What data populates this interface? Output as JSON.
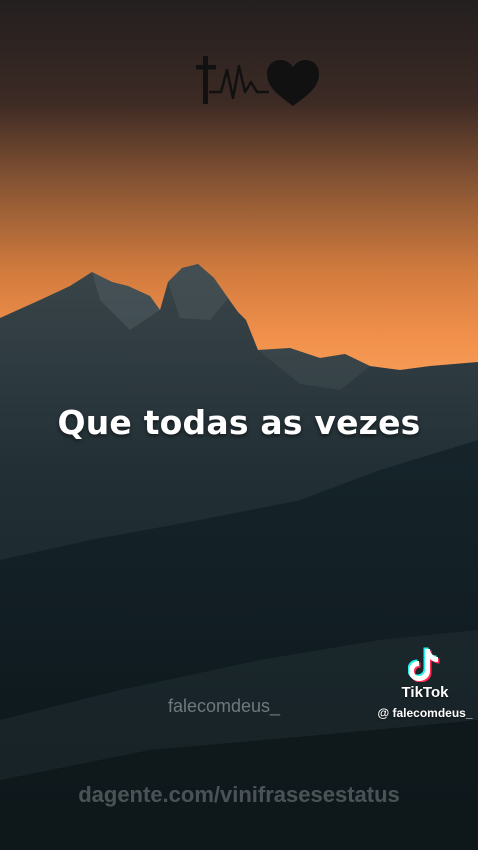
{
  "video": {
    "caption": "Que todas as vezes",
    "watermark_user": "falecomdeus_",
    "watermark_site": "dagente.com/vinifrasesestatus",
    "symbol_icons": [
      "cross-icon",
      "heartbeat-line-icon",
      "heart-icon"
    ]
  },
  "tiktok": {
    "name": "TikTok",
    "handle": "@ falecomdeus_"
  },
  "colors": {
    "sky_top": "#2a2523",
    "sky_glow": "#f2904a",
    "mountain_dark": "#142228",
    "text": "#ffffff"
  }
}
